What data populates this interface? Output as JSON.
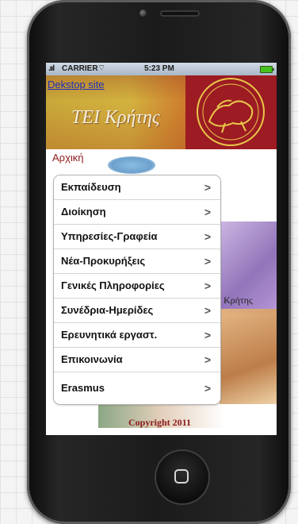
{
  "status_bar": {
    "signal": ".ııl",
    "carrier": "CARRIER",
    "wifi": "⌔",
    "time": "5:23 PM"
  },
  "header": {
    "desktop_link": "Dekstop site",
    "title": "TEI Κρήτης"
  },
  "home_link": "Αρχική",
  "menu": [
    {
      "label": "Εκπαίδευση",
      "chevron": ">"
    },
    {
      "label": "Διοίκηση",
      "chevron": ">"
    },
    {
      "label": "Υπηρεσίες-Γραφεία",
      "chevron": ">"
    },
    {
      "label": "Νέα-Προκυρήξεις",
      "chevron": ">"
    },
    {
      "label": "Γενικές Πληροφορίες",
      "chevron": ">"
    },
    {
      "label": "Συνέδρια-Ημερίδες",
      "chevron": ">"
    },
    {
      "label": "Ερευνητικά εργαστ.",
      "chevron": ">"
    },
    {
      "label": "Επικοινωνία",
      "chevron": ">"
    },
    {
      "label": "Erasmus",
      "chevron": ">"
    }
  ],
  "background_text": "Κρήτης",
  "copyright": "Copyright 2011",
  "colors": {
    "link_blue": "#1c2fb8",
    "home_red": "#8b1a1a",
    "banner_gold": "#caa93a",
    "seal_red": "#9d1b22"
  },
  "icons": {
    "wifi": "wifi-icon",
    "battery": "battery-icon",
    "chevron": "chevron-right-icon",
    "home_button": "home-button-icon"
  }
}
